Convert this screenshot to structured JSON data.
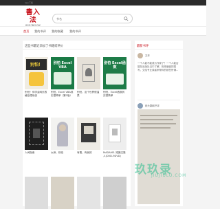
{
  "topbar": {
    "text": "App下载"
  },
  "logo": {
    "cn": "書入法",
    "en": "SHUBOOK"
  },
  "search": {
    "placeholder": "书名"
  },
  "nav": {
    "items": [
      "首页",
      "我的书评",
      "我的收藏",
      "我的书评"
    ]
  },
  "main": {
    "title": "这些书最近添加了书籍或评价",
    "books": [
      {
        "title": "别怕！你学会网页表格处理系统",
        "cover_text": "别怕！",
        "cover_color": "#2c2c2c"
      },
      {
        "title": "别怕，Excel VBA其实很简单（第2版）",
        "cover_text": "别怕 Excel VBA",
        "cover_color": "#1a7a45"
      },
      {
        "title": "别怕，这个世界很温柔",
        "cover_text": "",
        "cover_color": "#e6e1d8"
      },
      {
        "title": "别怕，Excel函数其实很简单",
        "cover_text": "别怕 Excel函数",
        "cover_color": "#1e7c48"
      },
      {
        "title": "人间指南",
        "cover_text": "",
        "cover_color": "#1f1f1f"
      },
      {
        "title": "大师，别怕",
        "cover_text": "",
        "cover_color": "#f2f2f0"
      },
      {
        "title": "有着，有我的",
        "cover_text": "",
        "cover_color": "#efece5"
      },
      {
        "title": "MADAME..短篇文集 人(DVD-9DVD)",
        "cover_text": "",
        "cover_color": "#eeeeee"
      }
    ]
  },
  "side": {
    "title": "最新书评",
    "entries": [
      {
        "user": "文年",
        "text": "一个人能不能成为作家了？一个人能否能在出版社当中了解，相传编者的描写，交给专业读者来帮你的那些所谓..."
      },
      {
        "user": "纸头翻阅书评",
        "text": ""
      }
    ]
  },
  "watermark": {
    "main": "玖玖录",
    "sub": "JIUJIULU.COM"
  }
}
